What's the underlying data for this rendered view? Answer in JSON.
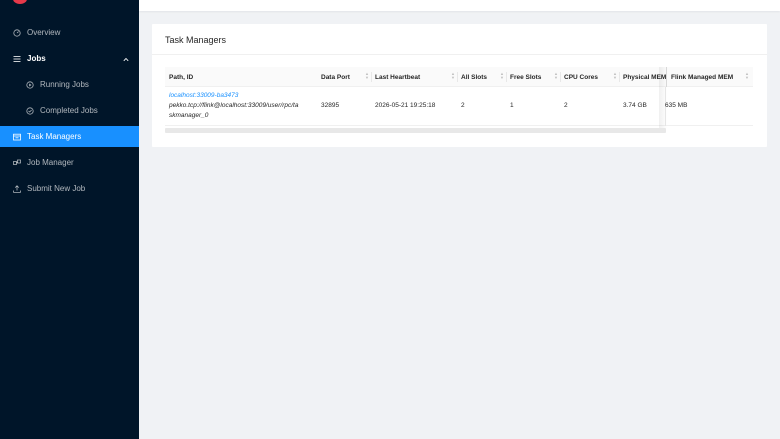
{
  "sidebar": {
    "items": [
      {
        "label": "Overview",
        "icon": "dashboard-icon"
      },
      {
        "label": "Jobs",
        "icon": "list-icon"
      },
      {
        "label": "Running Jobs",
        "icon": "play-circle-icon"
      },
      {
        "label": "Completed Jobs",
        "icon": "check-circle-icon"
      },
      {
        "label": "Task Managers",
        "icon": "schedule-icon"
      },
      {
        "label": "Job Manager",
        "icon": "build-icon"
      },
      {
        "label": "Submit New Job",
        "icon": "upload-icon"
      }
    ],
    "accent_color": "#1890ff",
    "background_color": "#001529"
  },
  "card": {
    "title": "Task Managers"
  },
  "table": {
    "columns": [
      "Path, ID",
      "Data Port",
      "Last Heartbeat",
      "All Slots",
      "Free Slots",
      "CPU Cores",
      "Physical MEM",
      "Flink Managed MEM"
    ],
    "rows": [
      {
        "path_link": "localhost:33009-ba3473",
        "path_line2": "pekko.tcp://flink@localhost:33009/user/rpc/ta",
        "path_line3": "skmanager_0",
        "data_port": "32895",
        "last_heartbeat": "2026-05-21 19:25:18",
        "all_slots": "2",
        "free_slots": "1",
        "cpu_cores": "2",
        "physical_mem": "3.74 GB",
        "flink_managed_mem": "635 MB"
      }
    ]
  }
}
